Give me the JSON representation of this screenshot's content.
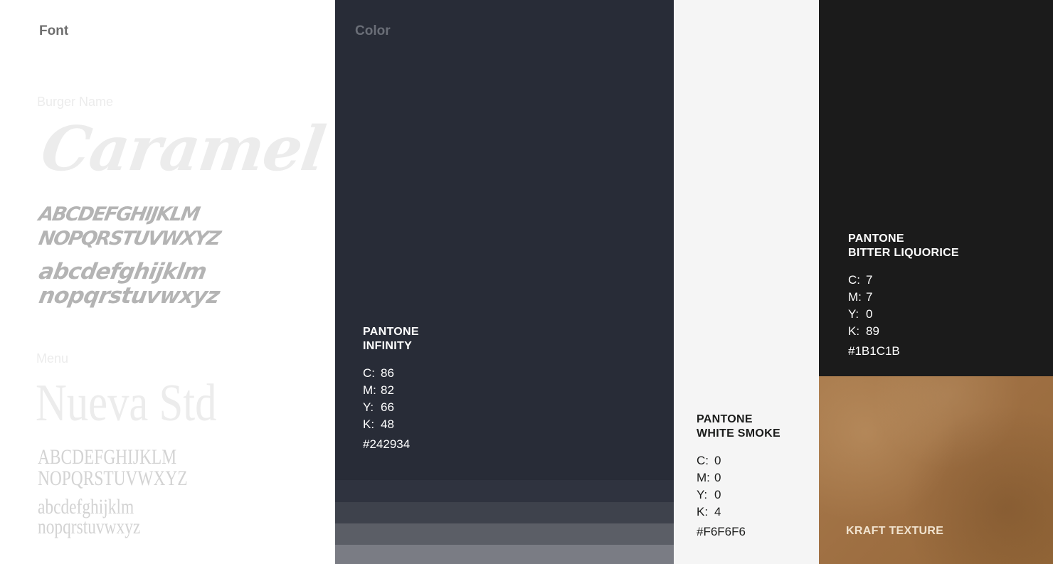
{
  "font_section": {
    "title": "Font",
    "burger": {
      "label": "Burger Name",
      "sample": "Caramel",
      "upper_1": "ABCDEFGHIJKLM",
      "upper_2": "NOPQRSTUVWXYZ",
      "lower_1": "abcdefghijklm",
      "lower_2": "nopqrstuvwxyz"
    },
    "menu": {
      "label": "Menu",
      "sample": "Nueva Std",
      "upper_1": "ABCDEFGHIJKLM",
      "upper_2": "NOPQRSTUVWXYZ",
      "lower_1": "abcdefghijklm",
      "lower_2": "nopqrstuvwxyz"
    }
  },
  "color_section": {
    "title": "Color",
    "swatches": [
      {
        "brand": "PANTONE",
        "name": "INFINITY",
        "c": "86",
        "m": "82",
        "y": "66",
        "k": "48",
        "hex": "#242934",
        "color": "#282c37"
      },
      {
        "brand": "PANTONE",
        "name": "WHITE SMOKE",
        "c": "0",
        "m": "0",
        "y": "0",
        "k": "4",
        "hex": "#F6F6F6",
        "color": "#f5f5f5"
      },
      {
        "brand": "PANTONE",
        "name": "BITTER LIQUORICE",
        "c": "7",
        "m": "7",
        "y": "0",
        "k": "89",
        "hex": "#1B1C1B",
        "color": "#1b1b1b"
      }
    ],
    "cmyk_labels": {
      "c": "C:",
      "m": "M:",
      "y": "Y:",
      "k": "K:"
    },
    "tints": [
      "#2f333f",
      "#3e424c",
      "#5b5e66",
      "#7a7c84"
    ],
    "texture": {
      "label": "KRAFT TEXTURE",
      "color": "#a0723f"
    }
  }
}
